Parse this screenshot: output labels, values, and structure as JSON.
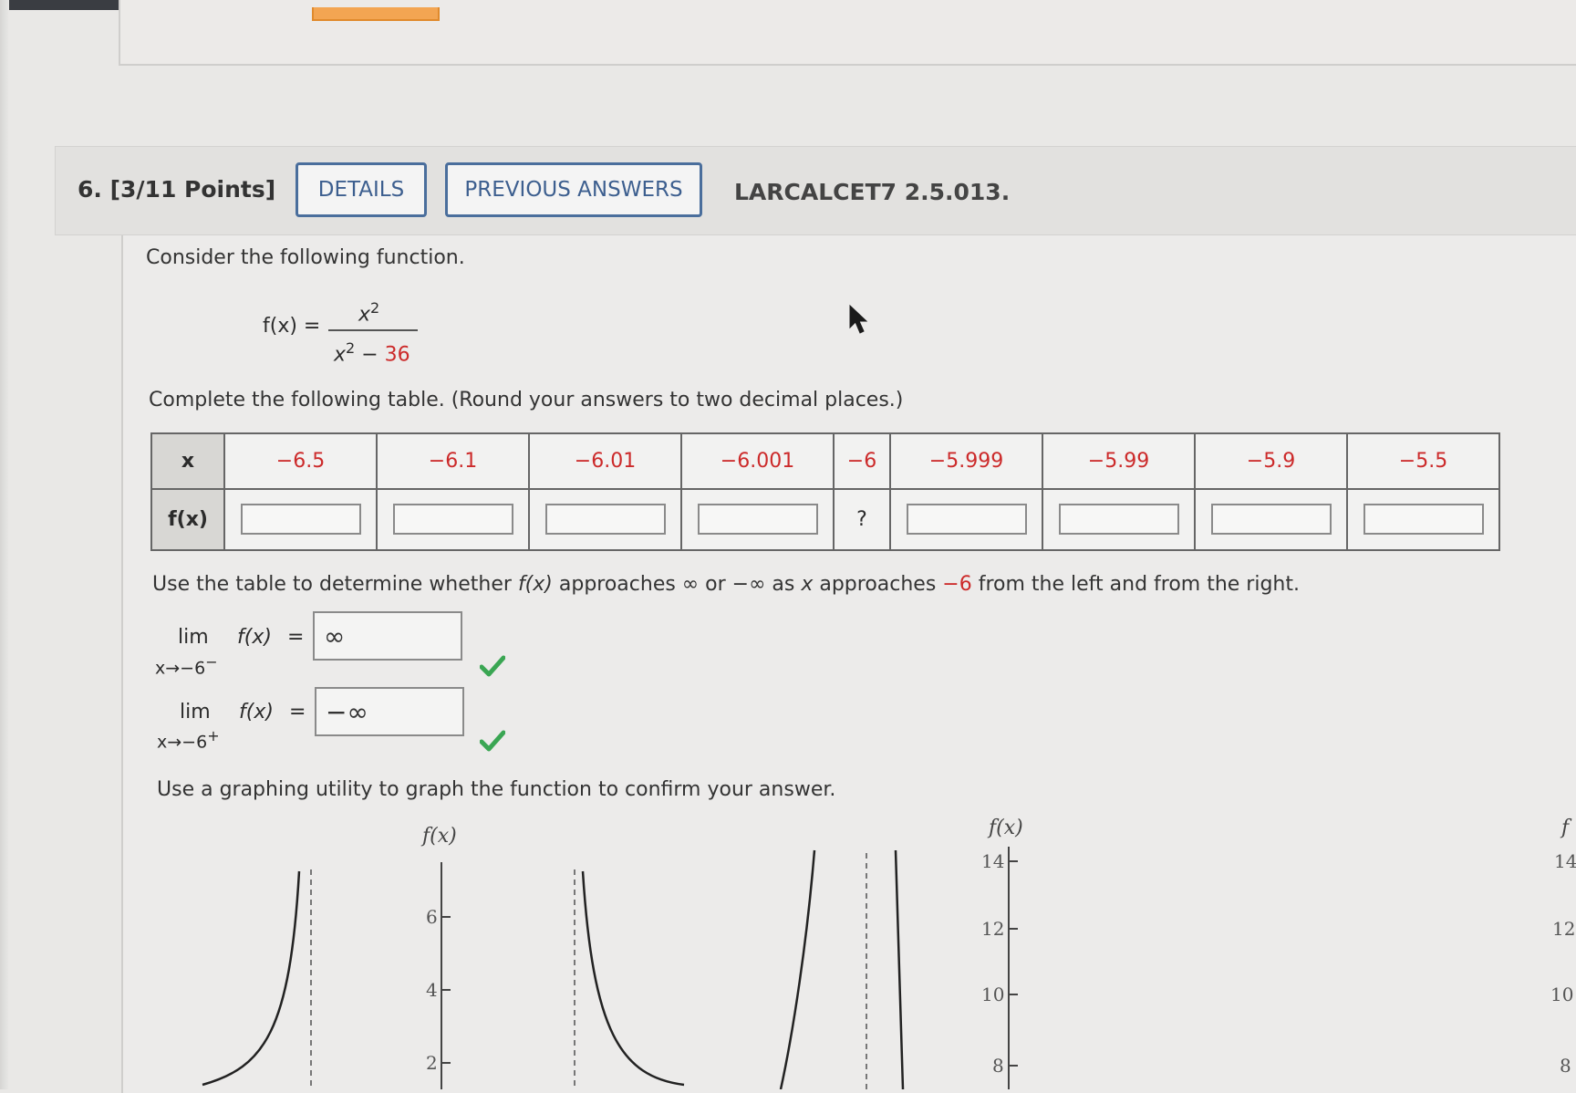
{
  "question": {
    "number_points": "6. [3/11 Points]",
    "details_label": "DETAILS",
    "previous_answers_label": "PREVIOUS ANSWERS",
    "problem_id": "LARCALCET7 2.5.013."
  },
  "prompt": {
    "consider": "Consider the following function.",
    "function_lhs": "f(x) =",
    "numerator": "x",
    "numerator_exp": "2",
    "denominator_base": "x",
    "denominator_exp": "2",
    "denominator_minus": " − ",
    "denominator_const": "36",
    "complete_table": "Complete the following table. (Round your answers to two decimal places.)"
  },
  "table": {
    "x_header": "x",
    "fx_header": "f(x)",
    "x_values": [
      "−6.5",
      "−6.1",
      "−6.01",
      "−6.001",
      "−6",
      "−5.999",
      "−5.99",
      "−5.9",
      "−5.5"
    ],
    "undefined_cell": "?"
  },
  "instructions": {
    "use_table_1": "Use the table to determine whether ",
    "use_table_fx": "f(x)",
    "use_table_2": " approaches ∞ or −∞ as ",
    "use_table_x": "x",
    "use_table_3": " approaches ",
    "use_table_neg6": "−6",
    "use_table_4": " from the left and from the right.",
    "graphing": "Use a graphing utility to graph the function to confirm your answer."
  },
  "limits": {
    "lim_word": "lim",
    "left_sub": "x→−6",
    "left_sup": "−",
    "right_sub": "x→−6",
    "right_sup": "+",
    "fx": "f(x)",
    "equals": "=",
    "left_answer": "∞",
    "right_answer": "−∞"
  },
  "graphs": {
    "axis_label": "f(x)",
    "graph1_ticks": [
      "6",
      "4",
      "2"
    ],
    "graph2_ticks": [
      "14",
      "12",
      "10",
      "8"
    ],
    "graph3_axis_label": "f",
    "graph3_ticks": [
      "14",
      "12",
      "10",
      "8"
    ]
  },
  "colors": {
    "accent_blue": "#4a6e9c",
    "red_value": "#cc2a2a",
    "check_green": "#3aa653"
  },
  "icons": {
    "check": "check-icon",
    "cursor": "mouse-cursor-icon"
  }
}
